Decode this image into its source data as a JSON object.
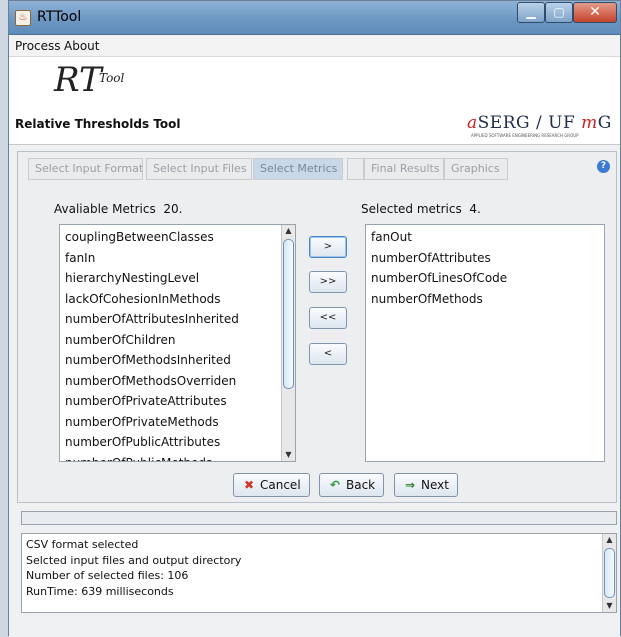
{
  "window": {
    "title": "RTTool"
  },
  "menu": {
    "items": [
      "Process",
      "About"
    ]
  },
  "header": {
    "logo_main": "RT",
    "logo_sub": "Tool",
    "subtitle": "Relative Thresholds Tool",
    "aserg_prefix": "a",
    "aserg_main": "SERG / UF",
    "aserg_m1": "m",
    "aserg_g": "G",
    "aserg_tag": "APPLIED SOFTWARE ENGINEERING RESEARCH GROUP"
  },
  "tabs": [
    {
      "label": "Select Input Format",
      "state": "disabled"
    },
    {
      "label": "Select Input Files",
      "state": "disabled"
    },
    {
      "label": "Select Metrics",
      "state": "active"
    },
    {
      "label": "",
      "state": "disabled"
    },
    {
      "label": "Final Results",
      "state": "disabled"
    },
    {
      "label": "Graphics",
      "state": "disabled"
    }
  ],
  "available": {
    "label": "Avaliable Metrics",
    "count": "20.",
    "items": [
      "couplingBetweenClasses",
      "fanIn",
      "hierarchyNestingLevel",
      "lackOfCohesionInMethods",
      "numberOfAttributesInherited",
      "numberOfChildren",
      "numberOfMethodsInherited",
      "numberOfMethodsOverriden",
      "numberOfPrivateAttributes",
      "numberOfPrivateMethods",
      "numberOfPublicAttributes",
      "numberOfPublicMethods"
    ]
  },
  "selected": {
    "label": "Selected metrics",
    "count": "4.",
    "items": [
      "fanOut",
      "numberOfAttributes",
      "numberOfLinesOfCode",
      "numberOfMethods"
    ]
  },
  "move_buttons": {
    "add": ">",
    "add_all": ">>",
    "remove_all": "<<",
    "remove": "<"
  },
  "nav": {
    "cancel": "Cancel",
    "back": "Back",
    "next": "Next"
  },
  "icons": {
    "app": "java-cup-icon",
    "cancel": "red-x-icon",
    "back": "green-back-arrow-icon",
    "next": "right-arrow-icon",
    "help": "help-icon"
  },
  "log": [
    "CSV format selected",
    "Selcted input files and output directory",
    "Number of selected files: 106",
    "RunTime: 639 milliseconds"
  ]
}
